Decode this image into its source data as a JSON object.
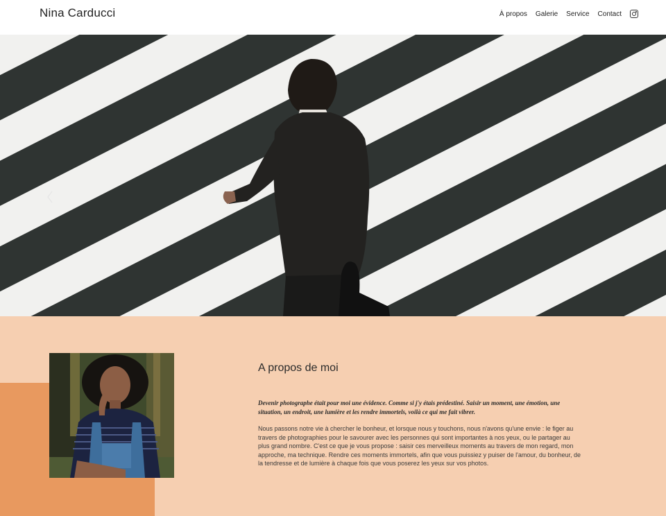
{
  "header": {
    "logo": "Nina Carducci",
    "nav": [
      {
        "label": "À propos"
      },
      {
        "label": "Galerie"
      },
      {
        "label": "Service"
      },
      {
        "label": "Contact"
      }
    ],
    "social_icon": "instagram-icon"
  },
  "hero": {
    "prev_icon": "chevron-left-icon"
  },
  "about": {
    "title": "A propos de moi",
    "intro": "Devenir photographe était pour moi une évidence. Comme si j'y étais prédestiné. Saisir un moment, une émotion, une situation, un endroit, une lumière et les rendre immortels, voilà ce qui me fait vibrer.",
    "body": "Nous passons notre vie à chercher le bonheur, et lorsque nous y touchons, nous n'avons qu'une envie : le figer au travers de photographies pour le savourer avec les personnes qui sont importantes à nos yeux, ou le partager au plus grand nombre. C'est ce que je vous propose : saisir ces merveilleux moments au travers de mon regard, mon approche, ma technique. Rendre ces moments immortels, afin que vous puissiez y puiser de l'amour, du bonheur, de la tendresse et de lumière à chaque fois que vous poserez les yeux sur vos photos."
  },
  "colors": {
    "section_bg": "#f6cfb1",
    "accent": "#e8995f"
  }
}
